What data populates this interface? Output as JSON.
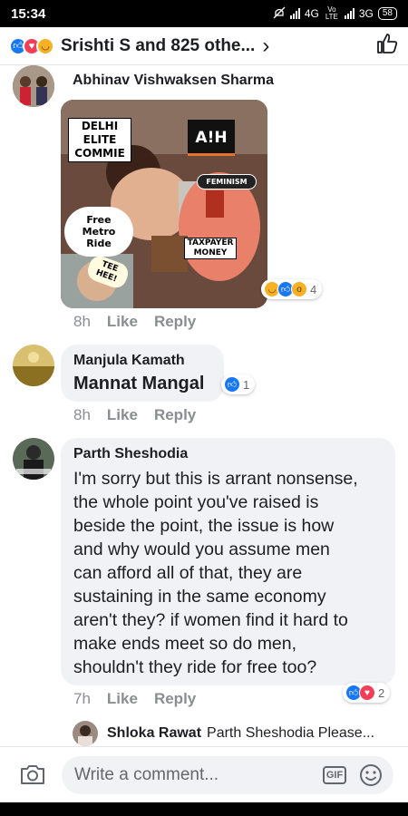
{
  "status_bar": {
    "time": "15:34",
    "network_1": "4G",
    "volte": "Vo LTE",
    "network_2": "3G",
    "battery": "58"
  },
  "header": {
    "title": "Srishti S and 825 othe...",
    "reactions": [
      "like",
      "love",
      "haha"
    ]
  },
  "comments": [
    {
      "author": "Abhinav Vishwaksen Sharma",
      "meme": {
        "top_left": "DELHI ELITE COMMIE",
        "logo": "A!H",
        "feminism": "FEMINISM",
        "free_metro": "Free Metro Ride",
        "taxpayer": "TAXPAYER MONEY",
        "kejriwal": "TEE HEE!"
      },
      "time": "8h",
      "like": "Like",
      "reply": "Reply",
      "reaction_count": "4",
      "reactions": [
        "haha",
        "like",
        "wow"
      ]
    },
    {
      "author": "Manjula Kamath",
      "text": "Mannat Mangal",
      "time": "8h",
      "like": "Like",
      "reply": "Reply",
      "reaction_count": "1",
      "reactions": [
        "like"
      ]
    },
    {
      "author": "Parth Sheshodia",
      "text_lines": [
        "I'm sorry but this is arrant nonsense,",
        "the whole point you've raised is",
        "beside the point, the issue is how",
        "and why would you assume men",
        "can afford all of that, they are",
        "sustaining in the same economy",
        "aren't they? if women find it hard to",
        "make ends meet so do men,",
        "shouldn't they ride for free too?"
      ],
      "time": "7h",
      "like": "Like",
      "reply": "Reply",
      "reaction_count": "2",
      "reactions": [
        "like",
        "love"
      ]
    }
  ],
  "reply_preview": {
    "author": "Shloka Rawat",
    "text": "Parth Sheshodia Please..."
  },
  "composer": {
    "placeholder": "Write a comment...",
    "gif_label": "GIF"
  }
}
